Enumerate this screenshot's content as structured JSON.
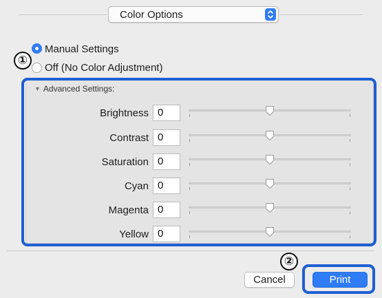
{
  "popup": {
    "label": "Color Options",
    "icon": "popup-arrows-icon"
  },
  "color_mode": {
    "options": [
      {
        "label": "Manual Settings",
        "selected": true
      },
      {
        "label": "Off (No Color Adjustment)",
        "selected": false
      }
    ]
  },
  "advanced": {
    "header": "Advanced Settings:",
    "disclosure_icon": "disclosure-triangle-down-icon",
    "rows": [
      {
        "label": "Brightness",
        "value": "0",
        "level": 0.5
      },
      {
        "label": "Contrast",
        "value": "0",
        "level": 0.5
      },
      {
        "label": "Saturation",
        "value": "0",
        "level": 0.5
      },
      {
        "label": "Cyan",
        "value": "0",
        "level": 0.5
      },
      {
        "label": "Magenta",
        "value": "0",
        "level": 0.5
      },
      {
        "label": "Yellow",
        "value": "0",
        "level": 0.5
      }
    ]
  },
  "callouts": {
    "one": "①",
    "two": "②"
  },
  "buttons": {
    "cancel": "Cancel",
    "print": "Print"
  },
  "colors": {
    "accent": "#2f7cf6",
    "highlight": "#1f5fd3",
    "background": "#ececec"
  }
}
